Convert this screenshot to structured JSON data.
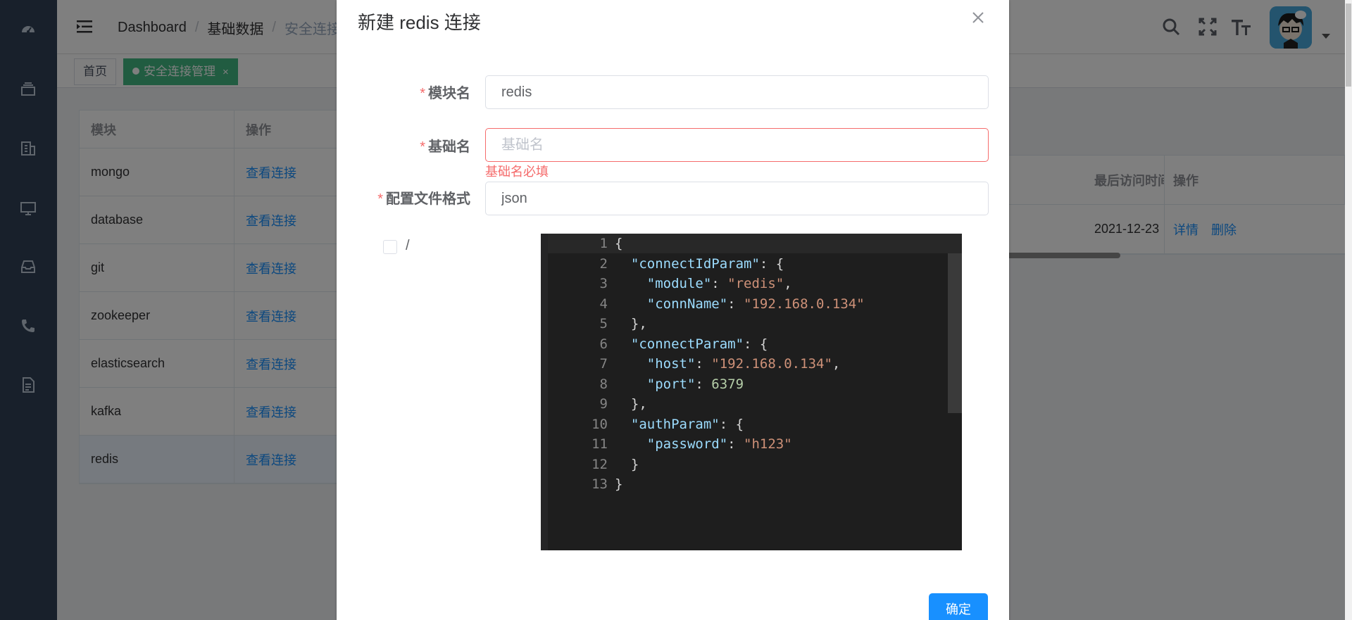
{
  "header": {
    "breadcrumb": [
      "Dashboard",
      "基础数据",
      "安全连接管理"
    ]
  },
  "sidebar": {
    "items": [
      {
        "icon": "dashboard-icon"
      },
      {
        "icon": "layers-icon"
      },
      {
        "icon": "building-icon"
      },
      {
        "icon": "monitor-icon"
      },
      {
        "icon": "inbox-icon"
      },
      {
        "icon": "phone-icon"
      },
      {
        "icon": "document-icon"
      }
    ]
  },
  "tags": {
    "home": "首页",
    "active": "安全连接管理",
    "close": "×"
  },
  "table": {
    "headers": [
      "模块",
      "操作"
    ],
    "rows": [
      {
        "module": "mongo",
        "action": "查看连接"
      },
      {
        "module": "database",
        "action": "查看连接"
      },
      {
        "module": "git",
        "action": "查看连接"
      },
      {
        "module": "zookeeper",
        "action": "查看连接"
      },
      {
        "module": "elasticsearch",
        "action": "查看连接"
      },
      {
        "module": "kafka",
        "action": "查看连接"
      },
      {
        "module": "redis",
        "action": "查看连接"
      }
    ]
  },
  "right_table": {
    "headers": [
      "最后访问时间",
      "操作"
    ],
    "row": {
      "last_access": "2021-12-23",
      "detail": "详情",
      "delete": "删除"
    }
  },
  "dialog": {
    "title": "新建 redis 连接",
    "close": "×",
    "module_label": "模块名",
    "module_value": "redis",
    "base_label": "基础名",
    "base_placeholder": "基础名",
    "base_error": "基础名必填",
    "format_label": "配置文件格式",
    "format_value": "json",
    "checkbox_label": "/",
    "confirm": "确定",
    "required_mark": "*"
  },
  "editor": {
    "lines": [
      "{",
      "  \"connectIdParam\": {",
      "    \"module\": \"redis\",",
      "    \"connName\": \"192.168.0.134\"",
      "  },",
      "  \"connectParam\": {",
      "    \"host\": \"192.168.0.134\",",
      "    \"port\": 6379",
      "  },",
      "  \"authParam\": {",
      "    \"password\": \"h123\"",
      "  }",
      "}"
    ]
  },
  "colors": {
    "sidebar": "#304156",
    "accent": "#1890ff",
    "tag_active": "#42b983",
    "error": "#f56c6c"
  }
}
